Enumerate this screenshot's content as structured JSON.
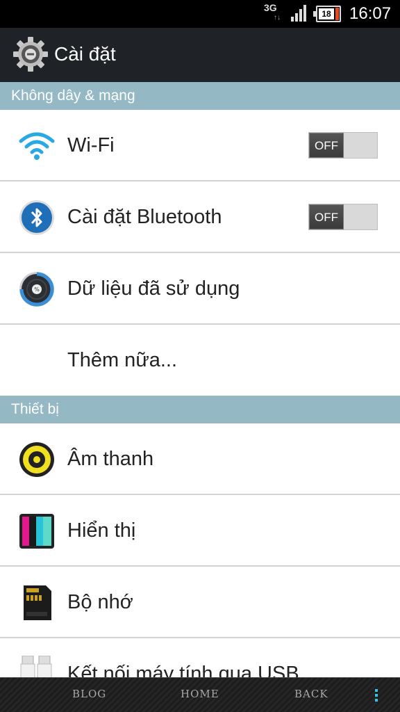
{
  "status_bar": {
    "network_type": "3G",
    "network_sub": "↑↓",
    "battery_level": "18",
    "time": "16:07"
  },
  "action_bar": {
    "title": "Cài đặt"
  },
  "sections": [
    {
      "header": "Không dây & mạng",
      "items": [
        {
          "label": "Wi-Fi",
          "toggle": "OFF"
        },
        {
          "label": "Cài đặt Bluetooth",
          "toggle": "OFF"
        },
        {
          "label": "Dữ liệu đã sử dụng"
        },
        {
          "label": "Thêm nữa..."
        }
      ]
    },
    {
      "header": "Thiết bị",
      "items": [
        {
          "label": "Âm thanh"
        },
        {
          "label": "Hiển thị"
        },
        {
          "label": "Bộ nhớ"
        },
        {
          "label": "Kết nối máy tính qua USB"
        }
      ]
    }
  ],
  "nav_bar": {
    "blog": "BLOG",
    "home": "HOME",
    "back": "BACK"
  },
  "colors": {
    "section_header": "#94b8c4",
    "action_bar": "#1f2226",
    "accent": "#36c3e5"
  }
}
